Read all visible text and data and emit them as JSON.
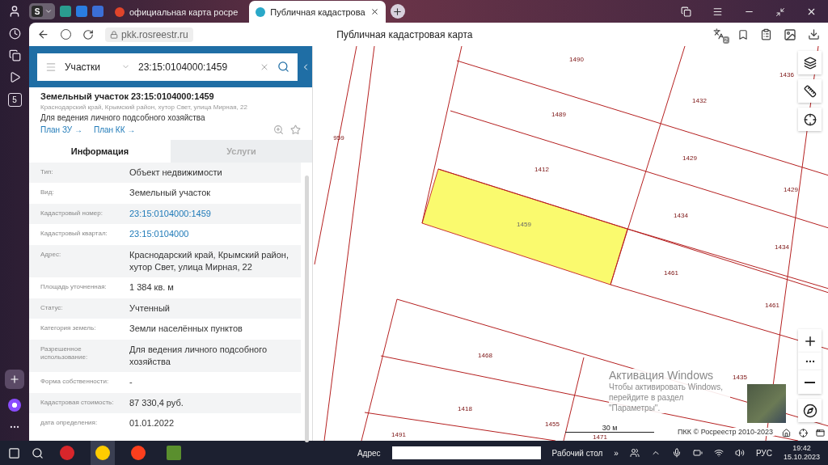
{
  "browser": {
    "tabs": [
      {
        "title": "официальная карта росре",
        "selected": false
      },
      {
        "title": "Публичная кадастрова",
        "selected": true
      }
    ],
    "group_letter": "S",
    "rail_badge": "5",
    "url": "pkk.rosreestr.ru",
    "page_title": "Публичная кадастровая карта",
    "translate_count": "2"
  },
  "search": {
    "category": "Участки",
    "query": "23:15:0104000:1459"
  },
  "card": {
    "title": "Земельный участок 23:15:0104000:1459",
    "address": "Краснодарский край, Крымский район, хутор Свет, улица Мирная, 22",
    "purpose": "Для ведения личного подсобного хозяйства",
    "links": [
      "План ЗУ →",
      "План КК →"
    ]
  },
  "info_tabs": [
    {
      "label": "Информация",
      "selected": true
    },
    {
      "label": "Услуги",
      "selected": false
    }
  ],
  "info_rows": [
    {
      "label": "Тип:",
      "value": "Объект недвижимости",
      "kind": "text"
    },
    {
      "label": "Вид:",
      "value": "Земельный участок",
      "kind": "text"
    },
    {
      "label": "Кадастровый номер:",
      "value": "23:15:0104000:1459",
      "kind": "link"
    },
    {
      "label": "Кадастровый квартал:",
      "value": "23:15:0104000",
      "kind": "link"
    },
    {
      "label": "Адрес:",
      "value": "Краснодарский край, Крымский район, хутор Свет, улица Мирная, 22",
      "kind": "text"
    },
    {
      "label": "Площадь уточненная:",
      "value": "1 384 кв. м",
      "kind": "text"
    },
    {
      "label": "Статус:",
      "value": "Учтенный",
      "kind": "text"
    },
    {
      "label": "Категория земель:",
      "value": "Земли населённых пунктов",
      "kind": "text"
    },
    {
      "label": "Разрешенное использование:",
      "value": "Для ведения личного подсобного хозяйства",
      "kind": "text"
    },
    {
      "label": "Форма собственности:",
      "value": "-",
      "kind": "text"
    },
    {
      "label": "Кадастровая стоимость:",
      "value": "87 330,4 руб.",
      "kind": "text"
    },
    {
      "label": "дата определения:",
      "value": "01.01.2022",
      "kind": "text"
    }
  ],
  "map": {
    "parcels": [
      {
        "number": "1490",
        "selected": false
      },
      {
        "number": "1432",
        "selected": false
      },
      {
        "number": "1489",
        "selected": false
      },
      {
        "number": "959",
        "selected": false
      },
      {
        "number": "1412",
        "selected": false
      },
      {
        "number": "1429",
        "selected": false
      },
      {
        "number": "1429",
        "selected": false
      },
      {
        "number": "1459",
        "selected": true
      },
      {
        "number": "1434",
        "selected": false
      },
      {
        "number": "1434",
        "selected": false
      },
      {
        "number": "1461",
        "selected": false
      },
      {
        "number": "1461",
        "selected": false
      },
      {
        "number": "1468",
        "selected": false
      },
      {
        "number": "1418",
        "selected": false
      },
      {
        "number": "1455",
        "selected": false
      },
      {
        "number": "1491",
        "selected": false
      },
      {
        "number": "1471",
        "selected": false
      },
      {
        "number": "1435",
        "selected": false
      },
      {
        "number": "1436",
        "selected": false
      }
    ],
    "scale": "30 м",
    "attribution": "ПКК © Росреестр 2010-2023"
  },
  "activation": {
    "title": "Активация Windows",
    "message": "Чтобы активировать Windows, перейдите в раздел \"Параметры\"."
  },
  "taskbar": {
    "address_label": "Адрес",
    "desktop_label": "Рабочий стол",
    "more": "»",
    "language": "РУС",
    "time": "19:42",
    "date": "15.10.2023"
  }
}
